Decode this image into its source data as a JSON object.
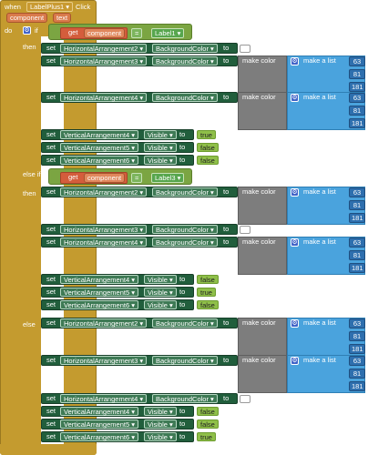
{
  "event": {
    "when": "when",
    "component": "LabelPlus1",
    "action": "Click",
    "params": [
      "component",
      "text"
    ],
    "do": "do"
  },
  "kw": {
    "if": "if",
    "then": "then",
    "else_if": "else if",
    "else": "else",
    "set": "set",
    "to": "to",
    "get": "get",
    "make_color": "make color",
    "make_list": "make a list",
    "bgcolor": "BackgroundColor",
    "visible": "Visible"
  },
  "cond1": {
    "var": "component",
    "op": "=",
    "label": "Label1"
  },
  "cond2": {
    "var": "component",
    "op": "=",
    "label": "Label3"
  },
  "rgb": [
    "63",
    "81",
    "181"
  ],
  "ha": [
    "HorizontalArrangement2",
    "HorizontalArrangement3",
    "HorizontalArrangement4"
  ],
  "va": [
    "VerticalArrangement4",
    "VerticalArrangement5",
    "VerticalArrangement6"
  ],
  "branch1_vis": [
    "true",
    "false",
    "false"
  ],
  "branch2_vis": [
    "false",
    "true",
    "false"
  ],
  "branch3_vis": [
    "false",
    "false",
    "true"
  ],
  "colors": {
    "event": "#c49b2f",
    "setter": "#215e3c",
    "color": "#7d7d7d",
    "list": "#4aa3dd",
    "number": "#2e6fae",
    "logic": "#8fbf49"
  }
}
